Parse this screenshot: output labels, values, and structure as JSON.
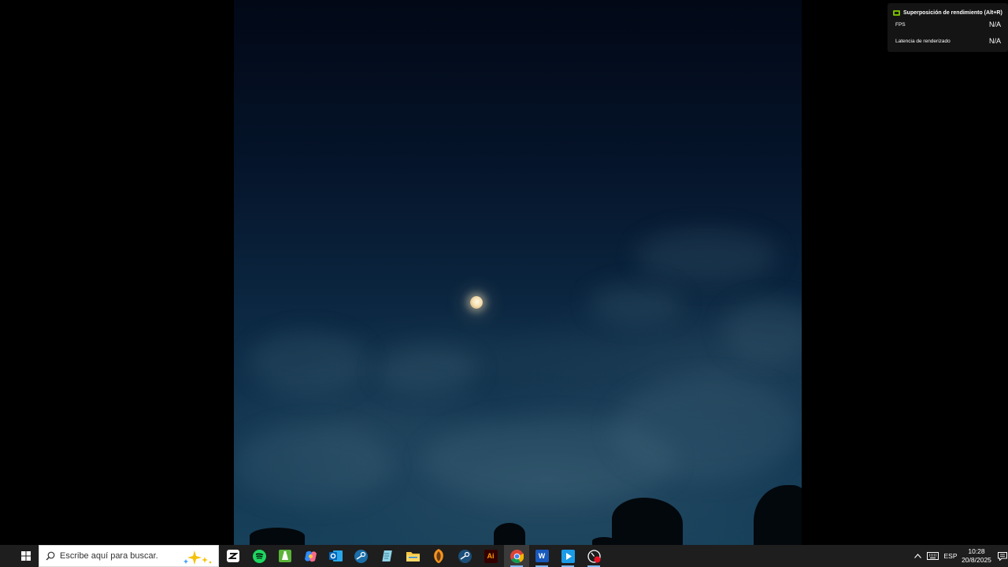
{
  "overlay": {
    "title": "Superposición de rendimiento (Alt+R)",
    "rows": [
      {
        "label": "FPS",
        "value": "N/A"
      },
      {
        "label": "Latencia de renderizado",
        "value": "N/A"
      }
    ]
  },
  "taskbar": {
    "search_placeholder": "Escribe aquí para buscar.",
    "apps": [
      {
        "name": "capcut-icon"
      },
      {
        "name": "spotify-icon"
      },
      {
        "name": "ccleaner-icon"
      },
      {
        "name": "copilot-icon"
      },
      {
        "name": "outlook-icon"
      },
      {
        "name": "steam-icon"
      },
      {
        "name": "notepad-icon"
      },
      {
        "name": "file-explorer-icon"
      },
      {
        "name": "fl-studio-icon"
      },
      {
        "name": "steam-icon"
      },
      {
        "name": "illustrator-icon"
      },
      {
        "name": "chrome-icon"
      },
      {
        "name": "word-icon"
      },
      {
        "name": "media-player-icon"
      },
      {
        "name": "screen-recorder-icon"
      }
    ],
    "illustrator_label": "Ai",
    "word_label": "W",
    "language": "ESP",
    "time": "10:28",
    "date": "20/8/2025"
  },
  "colors": {
    "taskbar": "#1e1e1e",
    "overlay_bg": "#141414",
    "nvidia_green": "#76b900",
    "sky_top": "#020816",
    "sky_bottom": "#17405a"
  }
}
